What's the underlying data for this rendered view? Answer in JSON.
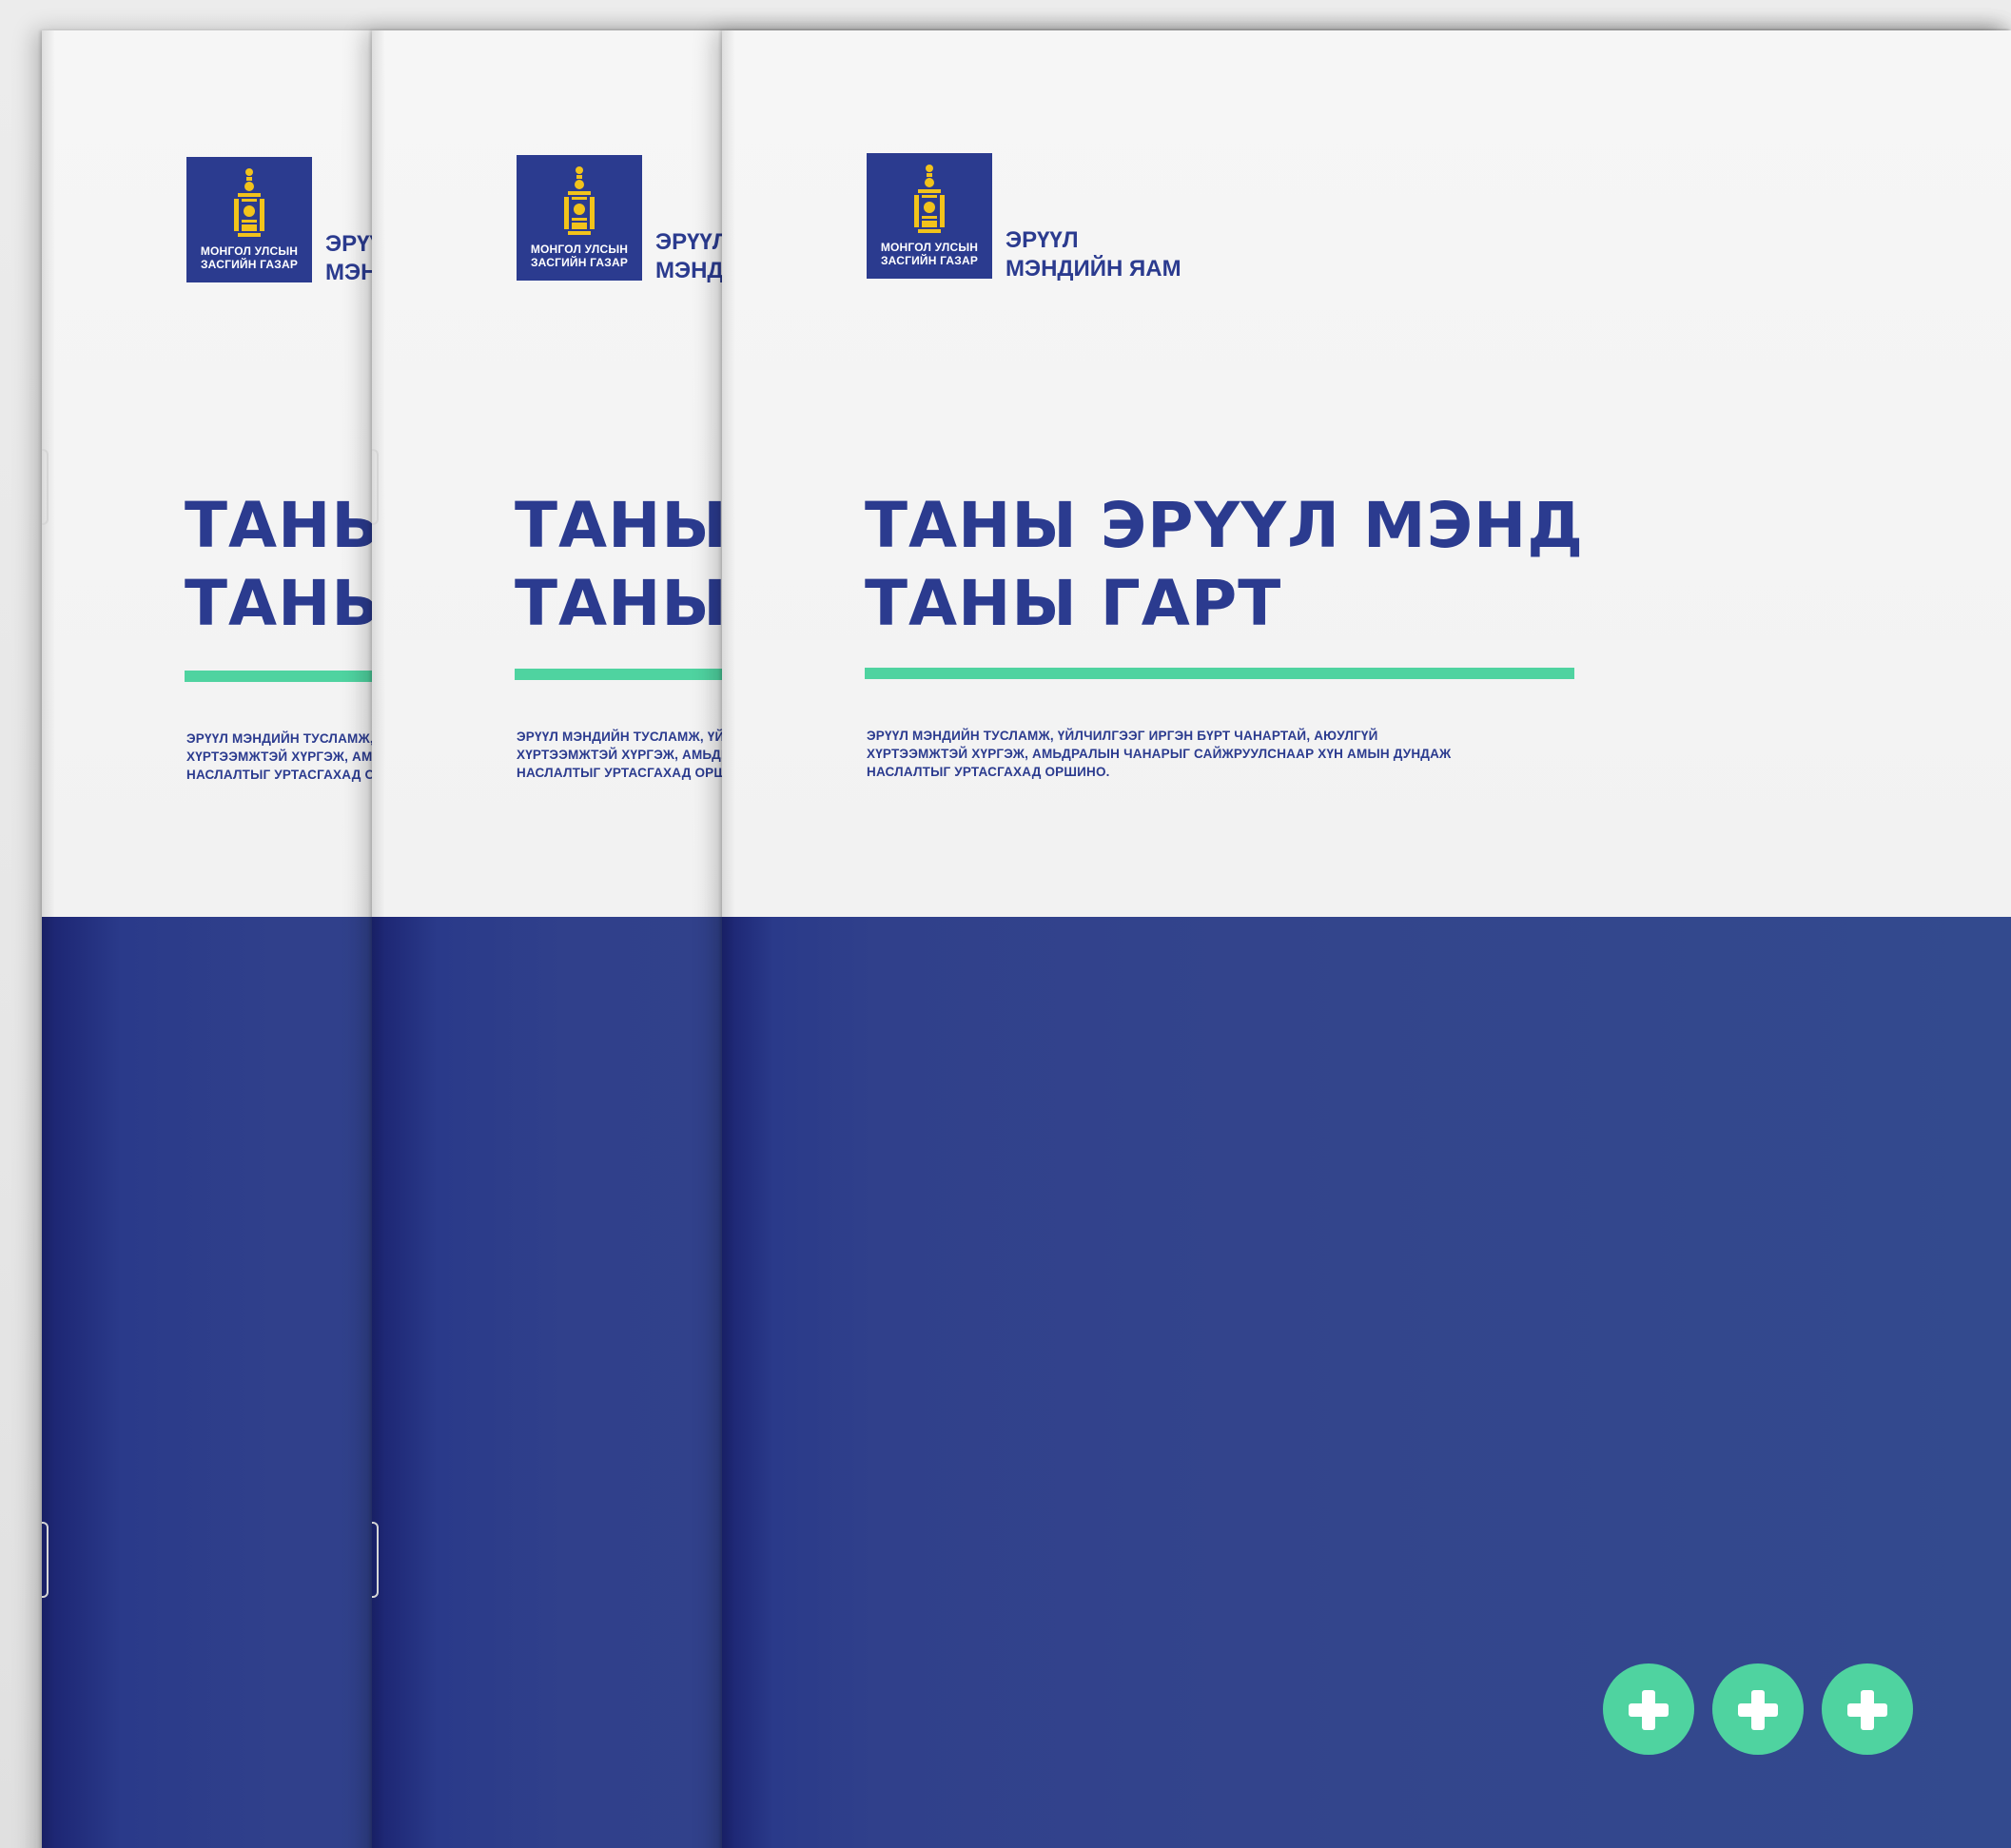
{
  "scene": {
    "description_label": "Booklet covers"
  },
  "booklet": {
    "logo_line1": "МОНГОЛ УЛСЫН",
    "logo_line2": "ЗАСГИЙН ГАЗАР",
    "ministry_line1": "ЭРҮҮЛ",
    "ministry_line2": "МЭНДИЙН ЯАМ",
    "title_line1": "ТАНЫ ЭРҮҮЛ МЭНД",
    "title_line2": "ТАНЫ ГАРТ",
    "tagline_line1": "ЭРҮҮЛ МЭНДИЙН ТУСЛАМЖ, ҮЙЛЧИЛГЭЭГ ИРГЭН БҮРТ ЧАНАРТАЙ, АЮУЛГҮЙ",
    "tagline_line2": "ХҮРТЭЭМЖТЭЙ ХҮРГЭЖ, АМЬДРАЛЫН ЧАНАРЫГ САЙЖРУУЛСНААР ХҮН АМЫН ДУНДАЖ",
    "tagline_line3": "НАСЛАЛТЫГ УРТАСГАХАД ОРШИНО."
  },
  "colors": {
    "brand_blue": "#2b3b8f",
    "cover_blue": "#334a8e",
    "accent_green": "#4fd3a0",
    "emblem_gold": "#f2c31b",
    "paper": "#f3f3f3"
  },
  "icons": {
    "emblem": "soyombo-emblem-icon",
    "plus": "plus-circle-icon",
    "plus_count": 3
  }
}
